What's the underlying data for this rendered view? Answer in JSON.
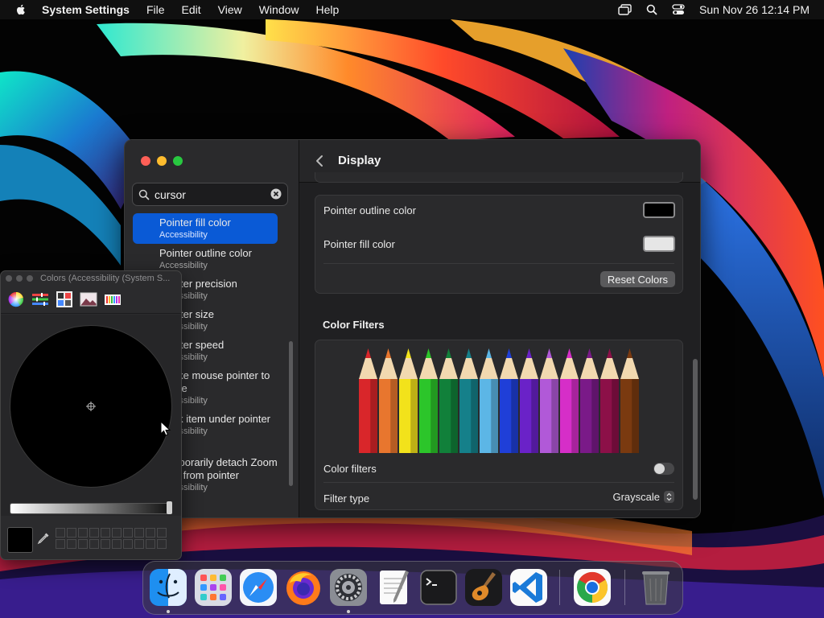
{
  "menubar": {
    "app_name": "System Settings",
    "items": [
      "File",
      "Edit",
      "View",
      "Window",
      "Help"
    ],
    "clock": "Sun Nov 26  12:14 PM"
  },
  "sidebar": {
    "search": {
      "value": "cursor"
    },
    "results": [
      {
        "title": "Pointer fill color",
        "subtitle": "Accessibility",
        "selected": true
      },
      {
        "title": "Pointer outline color",
        "subtitle": "Accessibility"
      },
      {
        "title": "Pointer precision",
        "subtitle": "Accessibility"
      },
      {
        "title": "Pointer size",
        "subtitle": "Accessibility"
      },
      {
        "title": "Pointer speed",
        "subtitle": "Accessibility"
      },
      {
        "title": "Shake mouse pointer to locate",
        "subtitle": "Accessibility"
      },
      {
        "title": "Dock item under pointer",
        "subtitle": "Accessibility"
      },
      {
        "title": "Temporarily detach Zoom view from pointer",
        "subtitle": "Accessibility"
      }
    ]
  },
  "content": {
    "title": "Display",
    "pointer_outline_color": {
      "label": "Pointer outline color",
      "color": "#000000"
    },
    "pointer_fill_color": {
      "label": "Pointer fill color",
      "color": "#e6e6e6"
    },
    "reset_button": "Reset Colors",
    "color_filters_section": "Color Filters",
    "color_filters_toggle": {
      "label": "Color filters",
      "on": false
    },
    "filter_type": {
      "label": "Filter type",
      "value": "Grayscale"
    },
    "pencil_colors": [
      "#d9262a",
      "#e8762e",
      "#f2e21b",
      "#2cc52a",
      "#11803a",
      "#15808a",
      "#5cb6e6",
      "#1f3fd8",
      "#6a22c8",
      "#b159d8",
      "#d62ec8",
      "#7a1a88",
      "#8c1048",
      "#7a3a10"
    ]
  },
  "colors_panel": {
    "title": "Colors (Accessibility (System S...",
    "current_color": "#000000"
  },
  "dock": {
    "apps": [
      "Finder",
      "Launchpad",
      "Safari",
      "Firefox",
      "System Settings",
      "TextEdit",
      "Terminal",
      "GarageBand",
      "Visual Studio Code",
      "Google Chrome",
      "Trash"
    ]
  }
}
